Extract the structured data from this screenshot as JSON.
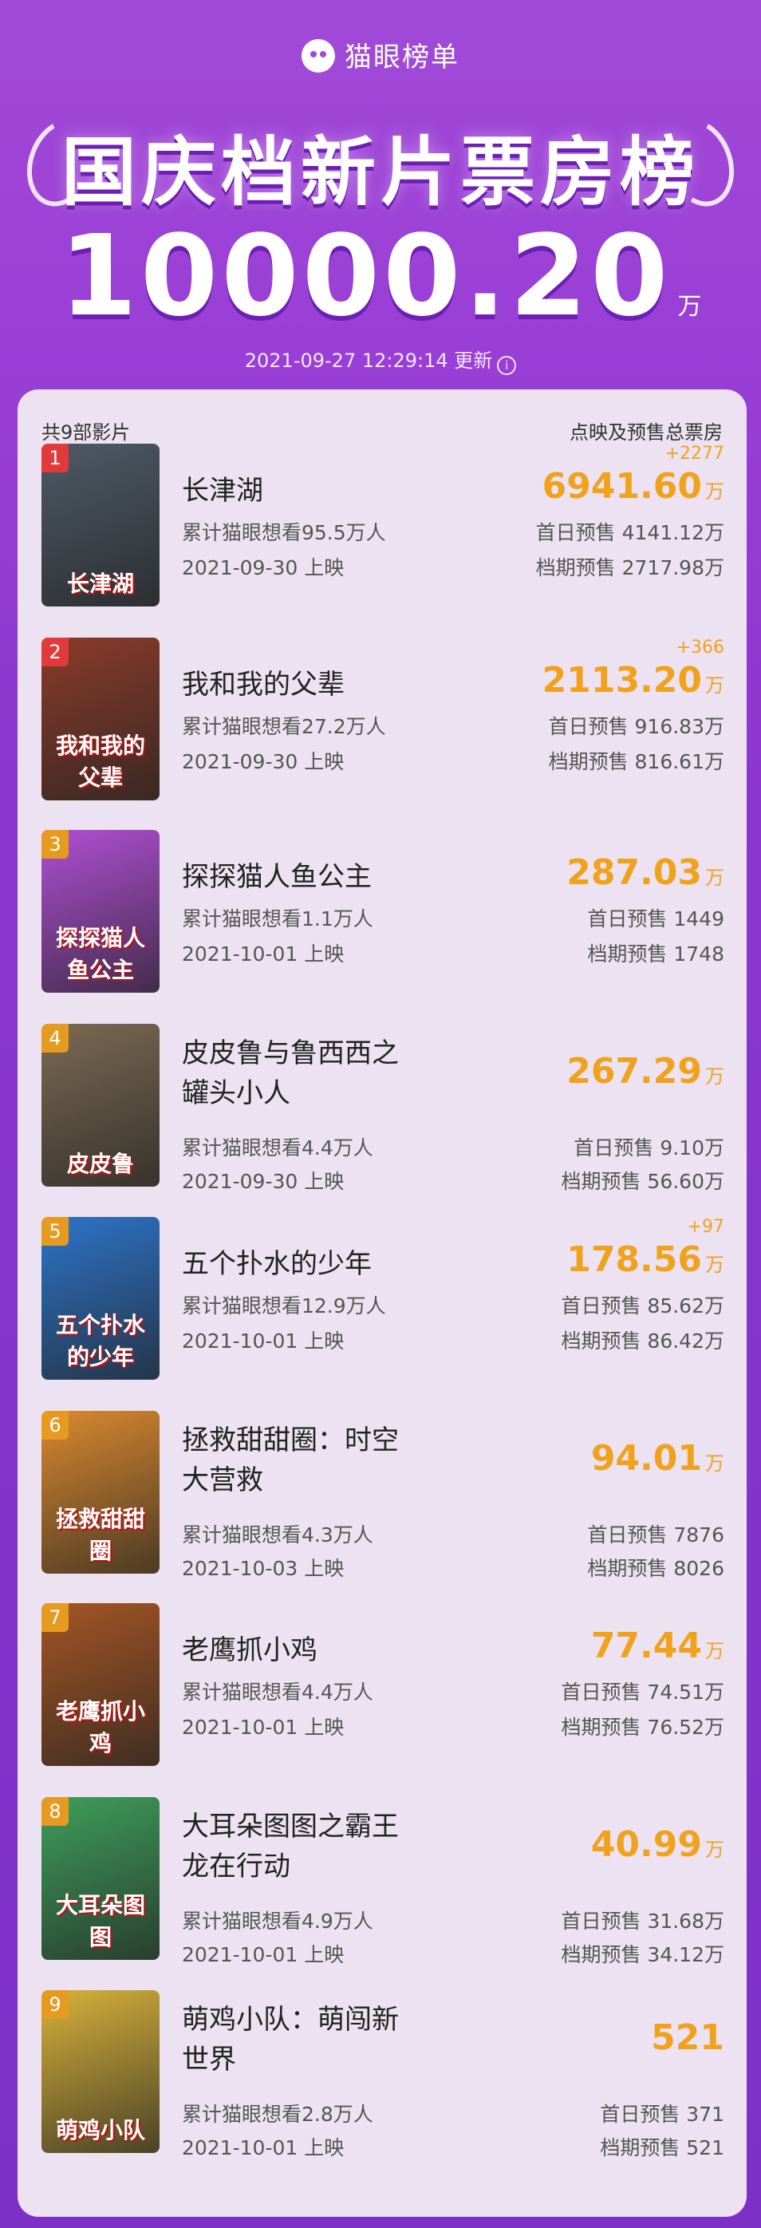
{
  "header": {
    "brand": "猫眼榜单",
    "title": "国庆档新片票房榜",
    "total": "10000.20",
    "total_unit": "万",
    "updated": "2021-09-27 12:29:14 更新"
  },
  "list": {
    "count_label": "共9部影片",
    "column_label": "点映及预售总票房",
    "unit": "万",
    "films": [
      {
        "rank": "1",
        "poster_text": "长津湖",
        "title_line1": "长津湖",
        "title_line2": "",
        "want": "累计猫眼想看95.5万人",
        "release": "2021-09-30 上映",
        "delta": "+2277",
        "box": "6941.60",
        "firstday": "首日预售 4141.12万",
        "period": "档期预售 2717.98万",
        "poster_bg": "#4e5a66"
      },
      {
        "rank": "2",
        "poster_text": "我和我的父辈",
        "title_line1": "我和我的父辈",
        "title_line2": "",
        "want": "累计猫眼想看27.2万人",
        "release": "2021-09-30 上映",
        "delta": "+366",
        "box": "2113.20",
        "firstday": "首日预售 916.83万",
        "period": "档期预售 816.61万",
        "poster_bg": "#8a3b2a"
      },
      {
        "rank": "3",
        "poster_text": "探探猫人鱼公主",
        "title_line1": "探探猫人鱼公主",
        "title_line2": "",
        "want": "累计猫眼想看1.1万人",
        "release": "2021-10-01 上映",
        "delta": "",
        "box": "287.03",
        "firstday": "首日预售 1449",
        "period": "档期预售 1748",
        "poster_bg": "#b04fd4"
      },
      {
        "rank": "4",
        "poster_text": "皮皮鲁",
        "title_line1": "皮皮鲁与鲁西西之",
        "title_line2": "罐头小人",
        "want": "累计猫眼想看4.4万人",
        "release": "2021-09-30 上映",
        "delta": "",
        "box": "267.29",
        "firstday": "首日预售 9.10万",
        "period": "档期预售 56.60万",
        "poster_bg": "#7b6a52"
      },
      {
        "rank": "5",
        "poster_text": "五个扑水的少年",
        "title_line1": "五个扑水的少年",
        "title_line2": "",
        "want": "累计猫眼想看12.9万人",
        "release": "2021-10-01 上映",
        "delta": "+97",
        "box": "178.56",
        "firstday": "首日预售 85.62万",
        "period": "档期预售 86.42万",
        "poster_bg": "#2d74c9"
      },
      {
        "rank": "6",
        "poster_text": "拯救甜甜圈",
        "title_line1": "拯救甜甜圈：时空",
        "title_line2": "大营救",
        "want": "累计猫眼想看4.3万人",
        "release": "2021-10-03 上映",
        "delta": "",
        "box": "94.01",
        "firstday": "首日预售 7876",
        "period": "档期预售 8026",
        "poster_bg": "#d9892f"
      },
      {
        "rank": "7",
        "poster_text": "老鹰抓小鸡",
        "title_line1": "老鹰抓小鸡",
        "title_line2": "",
        "want": "累计猫眼想看4.4万人",
        "release": "2021-10-01 上映",
        "delta": "",
        "box": "77.44",
        "firstday": "首日预售 74.51万",
        "period": "档期预售 76.52万",
        "poster_bg": "#a45524"
      },
      {
        "rank": "8",
        "poster_text": "大耳朵图图",
        "title_line1": "大耳朵图图之霸王",
        "title_line2": "龙在行动",
        "want": "累计猫眼想看4.9万人",
        "release": "2021-10-01 上映",
        "delta": "",
        "box": "40.99",
        "firstday": "首日预售 31.68万",
        "period": "档期预售 34.12万",
        "poster_bg": "#3e9e5a"
      },
      {
        "rank": "9",
        "poster_text": "萌鸡小队",
        "title_line1": "萌鸡小队：萌闯新",
        "title_line2": "世界",
        "want": "累计猫眼想看2.8万人",
        "release": "2021-10-01 上映",
        "delta": "",
        "box": "521",
        "firstday": "首日预售 371",
        "period": "档期预售 521",
        "poster_bg": "#d6b13a"
      }
    ]
  }
}
